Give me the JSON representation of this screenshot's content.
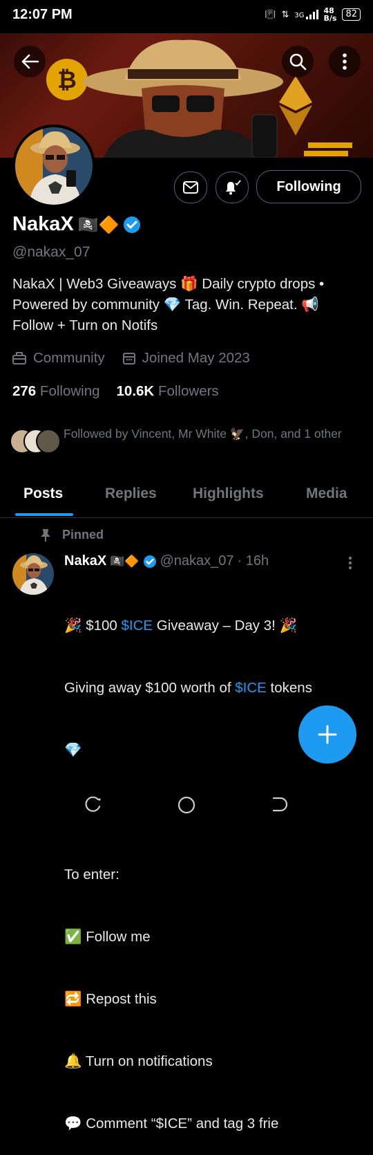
{
  "status": {
    "time": "12:07 PM",
    "net_type": "3G",
    "data_speed": "48",
    "data_unit": "B/s",
    "battery": "82"
  },
  "profile": {
    "name": "NakaX",
    "name_emoji": "🏴‍☠️🔶",
    "handle": "@nakax_07",
    "bio_line1": "NakaX | Web3 Giveaways 🎁 Daily crypto drops •",
    "bio_line2": "Powered by community 💎 Tag. Win. Repeat. 📢",
    "bio_line3": "Follow + Turn on Notifs",
    "category": "Community",
    "joined": "Joined May 2023",
    "following_count": "276",
    "following_label": "Following",
    "followers_count": "10.6K",
    "followers_label": "Followers",
    "followed_by": "Followed by Vincent, Mr White 🦅, Don, and 1 other"
  },
  "actions": {
    "follow_state": "Following"
  },
  "tabs": [
    "Posts",
    "Replies",
    "Highlights",
    "Media"
  ],
  "post": {
    "pinned_label": "Pinned",
    "author": "NakaX",
    "author_emoji": "🏴‍☠️🔶",
    "handle": "@nakax_07",
    "time": "· 16h",
    "line1_a": "🎉 $100 ",
    "line1_tag": "$ICE",
    "line1_b": " Giveaway – Day 3! 🎉",
    "line2_a": "Giving away $100 worth of ",
    "line2_tag": "$ICE",
    "line2_b": " tokens",
    "line3": "💎",
    "line4": "To enter:",
    "line5": "✅ Follow me",
    "line6": "🔁 Repost this",
    "line7": "🔔 Turn on notifications",
    "line8": "💬 Comment “$ICE” and tag 3 frie"
  },
  "colors": {
    "accent": "#1d9bf0",
    "muted": "#71767b"
  }
}
